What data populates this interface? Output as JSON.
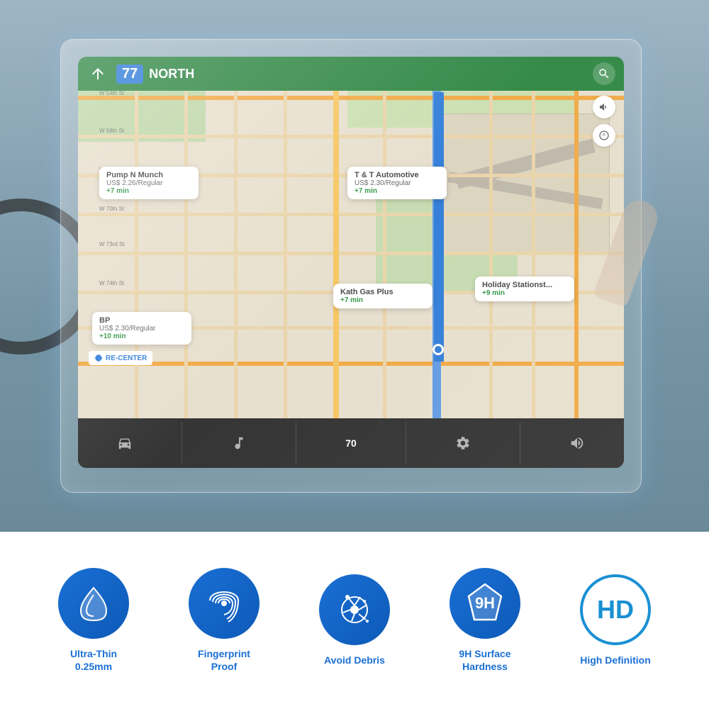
{
  "car": {
    "background_color": "#8fa8b8"
  },
  "screen": {
    "navigation": {
      "direction": "NORTH",
      "highway_number": "77",
      "search_icon": "search"
    },
    "gas_stations": [
      {
        "name": "Pump N Munch",
        "price": "US$ 2.26/Regular",
        "time": "+7 min"
      },
      {
        "name": "T & T Automotive",
        "price": "US$ 2.30/Regular",
        "time": "+7 min"
      },
      {
        "name": "Kath Gas Plus",
        "price": "",
        "time": "+7 min"
      },
      {
        "name": "BP",
        "price": "US$ 2.30/Regular",
        "time": "+10 min"
      },
      {
        "name": "Holiday Stationst...",
        "price": "",
        "time": "+9 min"
      }
    ],
    "recenter_label": "RE-CENTER",
    "speed": "70"
  },
  "features": [
    {
      "id": "ultra-thin",
      "icon": "shield-thin",
      "label": "Ultra-Thin\n0.25mm",
      "label_line1": "Ultra-Thin",
      "label_line2": "0.25mm"
    },
    {
      "id": "fingerprint-proof",
      "icon": "fingerprint",
      "label": "Fingerprint\nProof",
      "label_line1": "Fingerprint",
      "label_line2": "Proof"
    },
    {
      "id": "avoid-debris",
      "icon": "debris",
      "label": "Avoid Debris",
      "label_line1": "Avoid Debris",
      "label_line2": ""
    },
    {
      "id": "9h-hardness",
      "icon": "diamond-9h",
      "label": "9H Surface\nHardness",
      "label_line1": "9H Surface",
      "label_line2": "Hardness"
    },
    {
      "id": "high-definition",
      "icon": "hd",
      "label": "High Definition",
      "label_line1": "High Definition",
      "label_line2": ""
    }
  ],
  "colors": {
    "primary_blue": "#1a6fd4",
    "nav_green": "#1a7a30",
    "map_bg": "#e5dcc8",
    "screen_black": "#1a1a1a"
  }
}
